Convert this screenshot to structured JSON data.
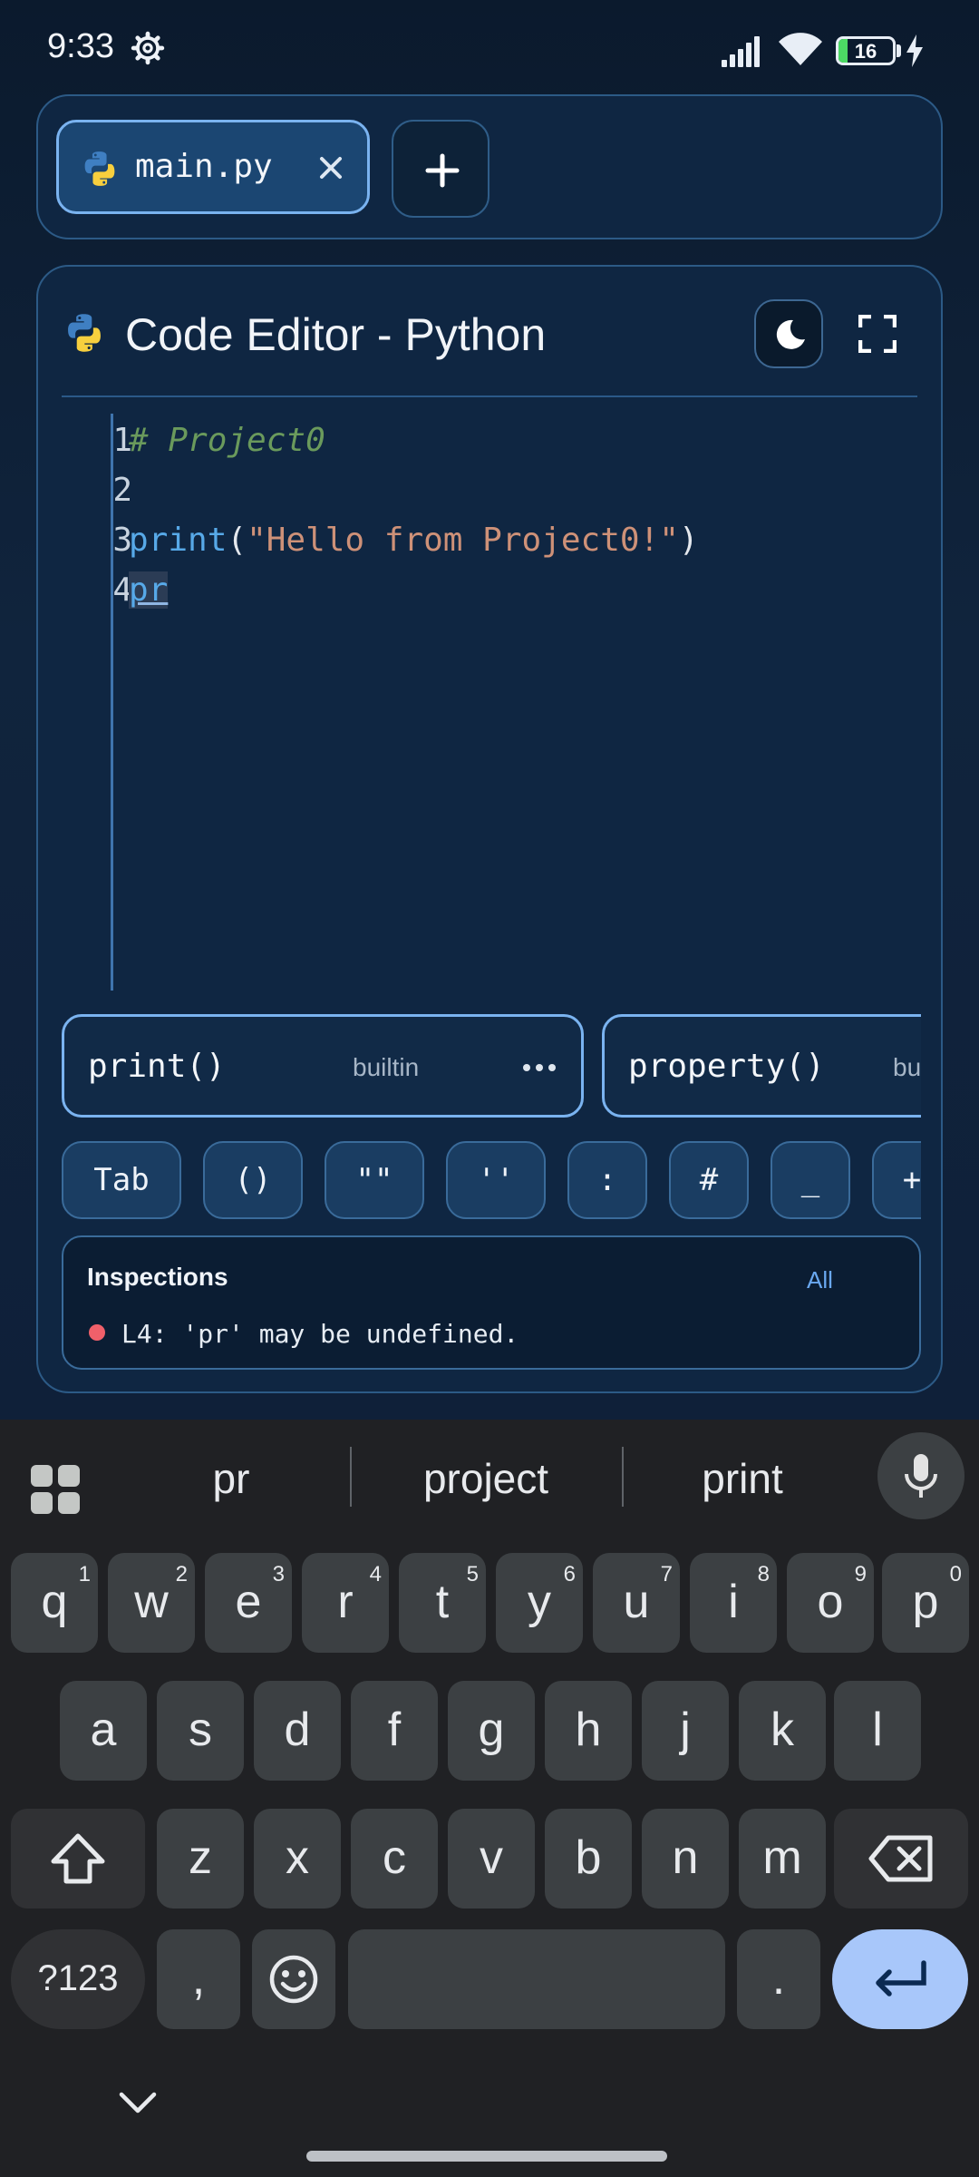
{
  "status_bar": {
    "time": "9:33",
    "battery": "16",
    "battery_level": 0.16
  },
  "tabs": {
    "file_tab_label": "main.py"
  },
  "editor": {
    "title": "Code Editor - Python",
    "line_numbers": [
      "1",
      "2",
      "3",
      "4"
    ],
    "lines": {
      "l1_comment": "# Project0",
      "l3_fn": "print",
      "l3_open": "(",
      "l3_str": "\"Hello from Project0!\"",
      "l3_close": ")",
      "l4_typed": "pr"
    }
  },
  "suggestions": [
    {
      "name": "print()",
      "kind": "builtin"
    },
    {
      "name": "property()",
      "kind": "builtin"
    }
  ],
  "quick_keys": [
    "Tab",
    "()",
    "\"\"",
    "''",
    ":",
    "#",
    "_",
    "+"
  ],
  "inspections": {
    "title": "Inspections",
    "filter": "All",
    "message": "L4: 'pr' may be undefined."
  },
  "keyboard": {
    "suggestions": [
      "pr",
      "project",
      "print"
    ],
    "row1": [
      "q",
      "w",
      "e",
      "r",
      "t",
      "y",
      "u",
      "i",
      "o",
      "p"
    ],
    "row1_hints": [
      "1",
      "2",
      "3",
      "4",
      "5",
      "6",
      "7",
      "8",
      "9",
      "0"
    ],
    "row2": [
      "a",
      "s",
      "d",
      "f",
      "g",
      "h",
      "j",
      "k",
      "l"
    ],
    "row3": [
      "z",
      "x",
      "c",
      "v",
      "b",
      "n",
      "m"
    ],
    "symbols_key": "?123",
    "comma_key": ",",
    "period_key": "."
  }
}
